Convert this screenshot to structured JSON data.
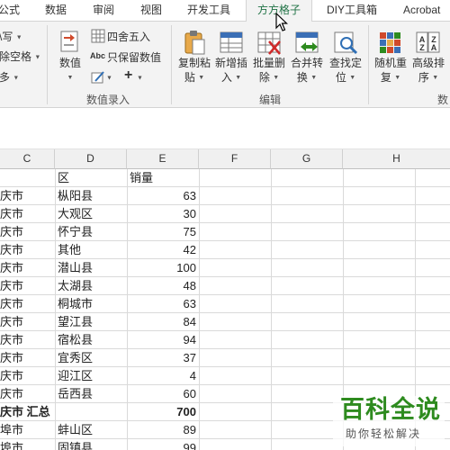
{
  "tabs": [
    "公式",
    "数据",
    "审阅",
    "视图",
    "开发工具",
    "方方格子",
    "DIY工具箱",
    "Acrobat"
  ],
  "active_tab": "方方格子",
  "ribbon": {
    "left_items": [
      "\\写",
      "除空格",
      "多"
    ],
    "numeric_button": "数值",
    "round_label": "四舍五入",
    "keep_value_label": "只保留数值",
    "abc_label": "Abc",
    "plus_label": "+",
    "group_numeric_entry": "数值录入",
    "copy_paste": [
      "复制粘",
      "贴"
    ],
    "new_insert": [
      "新增插",
      "入"
    ],
    "batch_delete": [
      "批量删",
      "除"
    ],
    "merge_convert": [
      "合并转",
      "换"
    ],
    "find_locate": [
      "查找定",
      "位"
    ],
    "group_edit": "编辑",
    "random_repeat": [
      "随机重",
      "复"
    ],
    "advanced_sort": [
      "高级排",
      "序"
    ],
    "group_data_partial": "数"
  },
  "columns": [
    "C",
    "D",
    "E",
    "F",
    "G",
    "H"
  ],
  "header_row": {
    "d": "区",
    "e": "销量"
  },
  "rows": [
    {
      "c": "庆市",
      "d": "枞阳县",
      "e": "63"
    },
    {
      "c": "庆市",
      "d": "大观区",
      "e": "30"
    },
    {
      "c": "庆市",
      "d": "怀宁县",
      "e": "75"
    },
    {
      "c": "庆市",
      "d": "其他",
      "e": "42"
    },
    {
      "c": "庆市",
      "d": "潜山县",
      "e": "100"
    },
    {
      "c": "庆市",
      "d": "太湖县",
      "e": "48"
    },
    {
      "c": "庆市",
      "d": "桐城市",
      "e": "63"
    },
    {
      "c": "庆市",
      "d": "望江县",
      "e": "84"
    },
    {
      "c": "庆市",
      "d": "宿松县",
      "e": "94"
    },
    {
      "c": "庆市",
      "d": "宜秀区",
      "e": "37"
    },
    {
      "c": "庆市",
      "d": "迎江区",
      "e": "4"
    },
    {
      "c": "庆市",
      "d": "岳西县",
      "e": "60"
    },
    {
      "c": "庆市 汇总",
      "d": "",
      "e": "700"
    },
    {
      "c": "埠市",
      "d": "蚌山区",
      "e": "89"
    },
    {
      "c": "埠市",
      "d": "固镇县",
      "e": "99"
    }
  ],
  "watermark": {
    "title": "百科全说",
    "subtitle": "助你轻松解决"
  },
  "colors": {
    "accent": "#217346",
    "watermark_green": "#2e8b1f",
    "ribbon_bg": "#f3f3f3"
  }
}
